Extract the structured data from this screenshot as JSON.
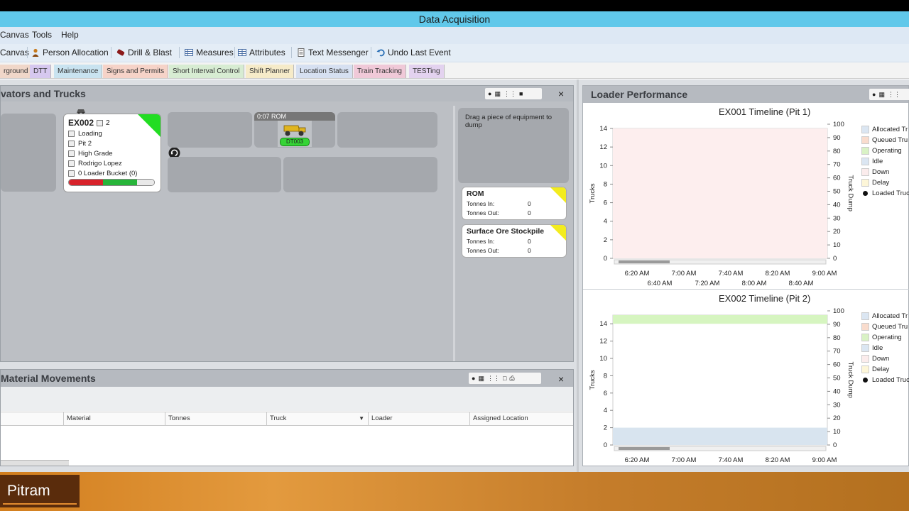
{
  "window": {
    "title": "Data Acquisition"
  },
  "menu": {
    "canvas": "Canvas",
    "tools": "Tools",
    "help": "Help"
  },
  "toolbar": {
    "canvas": "Canvas",
    "person_allocation": "Person Allocation",
    "drill_blast": "Drill & Blast",
    "measures": "Measures",
    "attributes": "Attributes",
    "text_messenger": "Text Messenger",
    "undo_last_event": "Undo Last Event"
  },
  "tabs": [
    {
      "label": "rground",
      "color": "#f0d7c9"
    },
    {
      "label": "DTT",
      "color": "#d6c8ef"
    },
    {
      "label": "Maintenance",
      "color": "#c9e3f0"
    },
    {
      "label": "Signs and Permits",
      "color": "#f6d3c8"
    },
    {
      "label": "Short Interval Control",
      "color": "#d7ecd2"
    },
    {
      "label": "Shift Planner",
      "color": "#f6ebc9"
    },
    {
      "label": "Location Status",
      "color": "#d6e0f1"
    },
    {
      "label": "Train Tracking",
      "color": "#f0c9d8"
    },
    {
      "label": "TESTing",
      "color": "#e3d2ef"
    }
  ],
  "excavators_panel": {
    "title": "vators and Trucks",
    "close": "×",
    "loader": {
      "id": "EX002",
      "count": "2",
      "status": "Loading",
      "location": "Pit 2",
      "material": "High Grade",
      "operator": "Rodrigo Lopez",
      "buckets": "0 Loader Bucket (0)"
    },
    "queue_label": "0:07 ROM",
    "truck_id": "DT003",
    "dump_hint": "Drag a piece of equipment to dump",
    "stockpiles": [
      {
        "name": "ROM",
        "tonnes_in_label": "Tonnes In:",
        "tonnes_in": "0",
        "tonnes_out_label": "Tonnes Out:",
        "tonnes_out": "0"
      },
      {
        "name": "Surface Ore Stockpile",
        "tonnes_in_label": "Tonnes In:",
        "tonnes_in": "0",
        "tonnes_out_label": "Tonnes Out:",
        "tonnes_out": "0"
      }
    ]
  },
  "material_movements": {
    "title": "Material Movements",
    "close": "×",
    "columns": [
      "Material",
      "Tonnes",
      "Truck",
      "Loader",
      "Assigned Location"
    ]
  },
  "loader_performance": {
    "title": "Loader Performance",
    "close": "×",
    "charts": [
      {
        "title": "EX001 Timeline (Pit 1)"
      },
      {
        "title": "EX002 Timeline (Pit 2)"
      }
    ]
  },
  "chart_data": [
    {
      "type": "area",
      "title": "EX001 Timeline (Pit 1)",
      "ylabel": "Trucks",
      "y2label": "Truck Dump",
      "ylim": [
        0,
        14
      ],
      "y2lim": [
        0,
        100
      ],
      "yticks": [
        "14",
        "12",
        "10",
        "8",
        "6",
        "4",
        "2",
        "0"
      ],
      "y2ticks": [
        "100",
        "90",
        "80",
        "70",
        "60",
        "50",
        "40",
        "30",
        "20",
        "10",
        "0"
      ],
      "xticks_row1": [
        "6:20 AM",
        "7:00 AM",
        "7:40 AM",
        "8:20 AM",
        "9:00 AM"
      ],
      "xticks_row2": [
        "6:40 AM",
        "7:20 AM",
        "8:00 AM",
        "8:40 AM"
      ],
      "legend": [
        "Allocated Tr",
        "Queued Tru",
        "Operating",
        "Idle",
        "Down",
        "Delay",
        "Loaded Truc"
      ],
      "legend_colors": [
        "#dbe6f2",
        "#f9dccd",
        "#d9f2c5",
        "#dbe6f2",
        "#fbecec",
        "#fdf6d8",
        "#111111"
      ],
      "bands": [
        {
          "state": "Down",
          "from": 0,
          "to": 14,
          "color": "#fdeeee"
        }
      ]
    },
    {
      "type": "area",
      "title": "EX002 Timeline (Pit 2)",
      "ylabel": "Trucks",
      "y2label": "Truck Dump",
      "ylim": [
        0,
        15
      ],
      "y2lim": [
        0,
        100
      ],
      "yticks": [
        "14",
        "12",
        "10",
        "8",
        "6",
        "4",
        "2",
        "0"
      ],
      "y2ticks": [
        "100",
        "90",
        "80",
        "70",
        "60",
        "50",
        "40",
        "30",
        "20",
        "10",
        "0"
      ],
      "xticks_row1": [
        "6:20 AM",
        "7:00 AM",
        "7:40 AM",
        "8:20 AM",
        "9:00 AM"
      ],
      "xticks_row2": [],
      "legend": [
        "Allocated Tr",
        "Queued Tru",
        "Operating",
        "Idle",
        "Down",
        "Delay",
        "Loaded Truc"
      ],
      "legend_colors": [
        "#dbe6f2",
        "#f9dccd",
        "#d9f2c5",
        "#dbe6f2",
        "#fbecec",
        "#fdf6d8",
        "#111111"
      ],
      "bands": [
        {
          "state": "Idle",
          "from": 0,
          "to": 2,
          "color": "#d8e4ef"
        },
        {
          "state": "Operating",
          "from": 14,
          "to": 15,
          "color": "#d6f5c0"
        }
      ]
    }
  ],
  "footer": {
    "logo": "Pitram"
  }
}
